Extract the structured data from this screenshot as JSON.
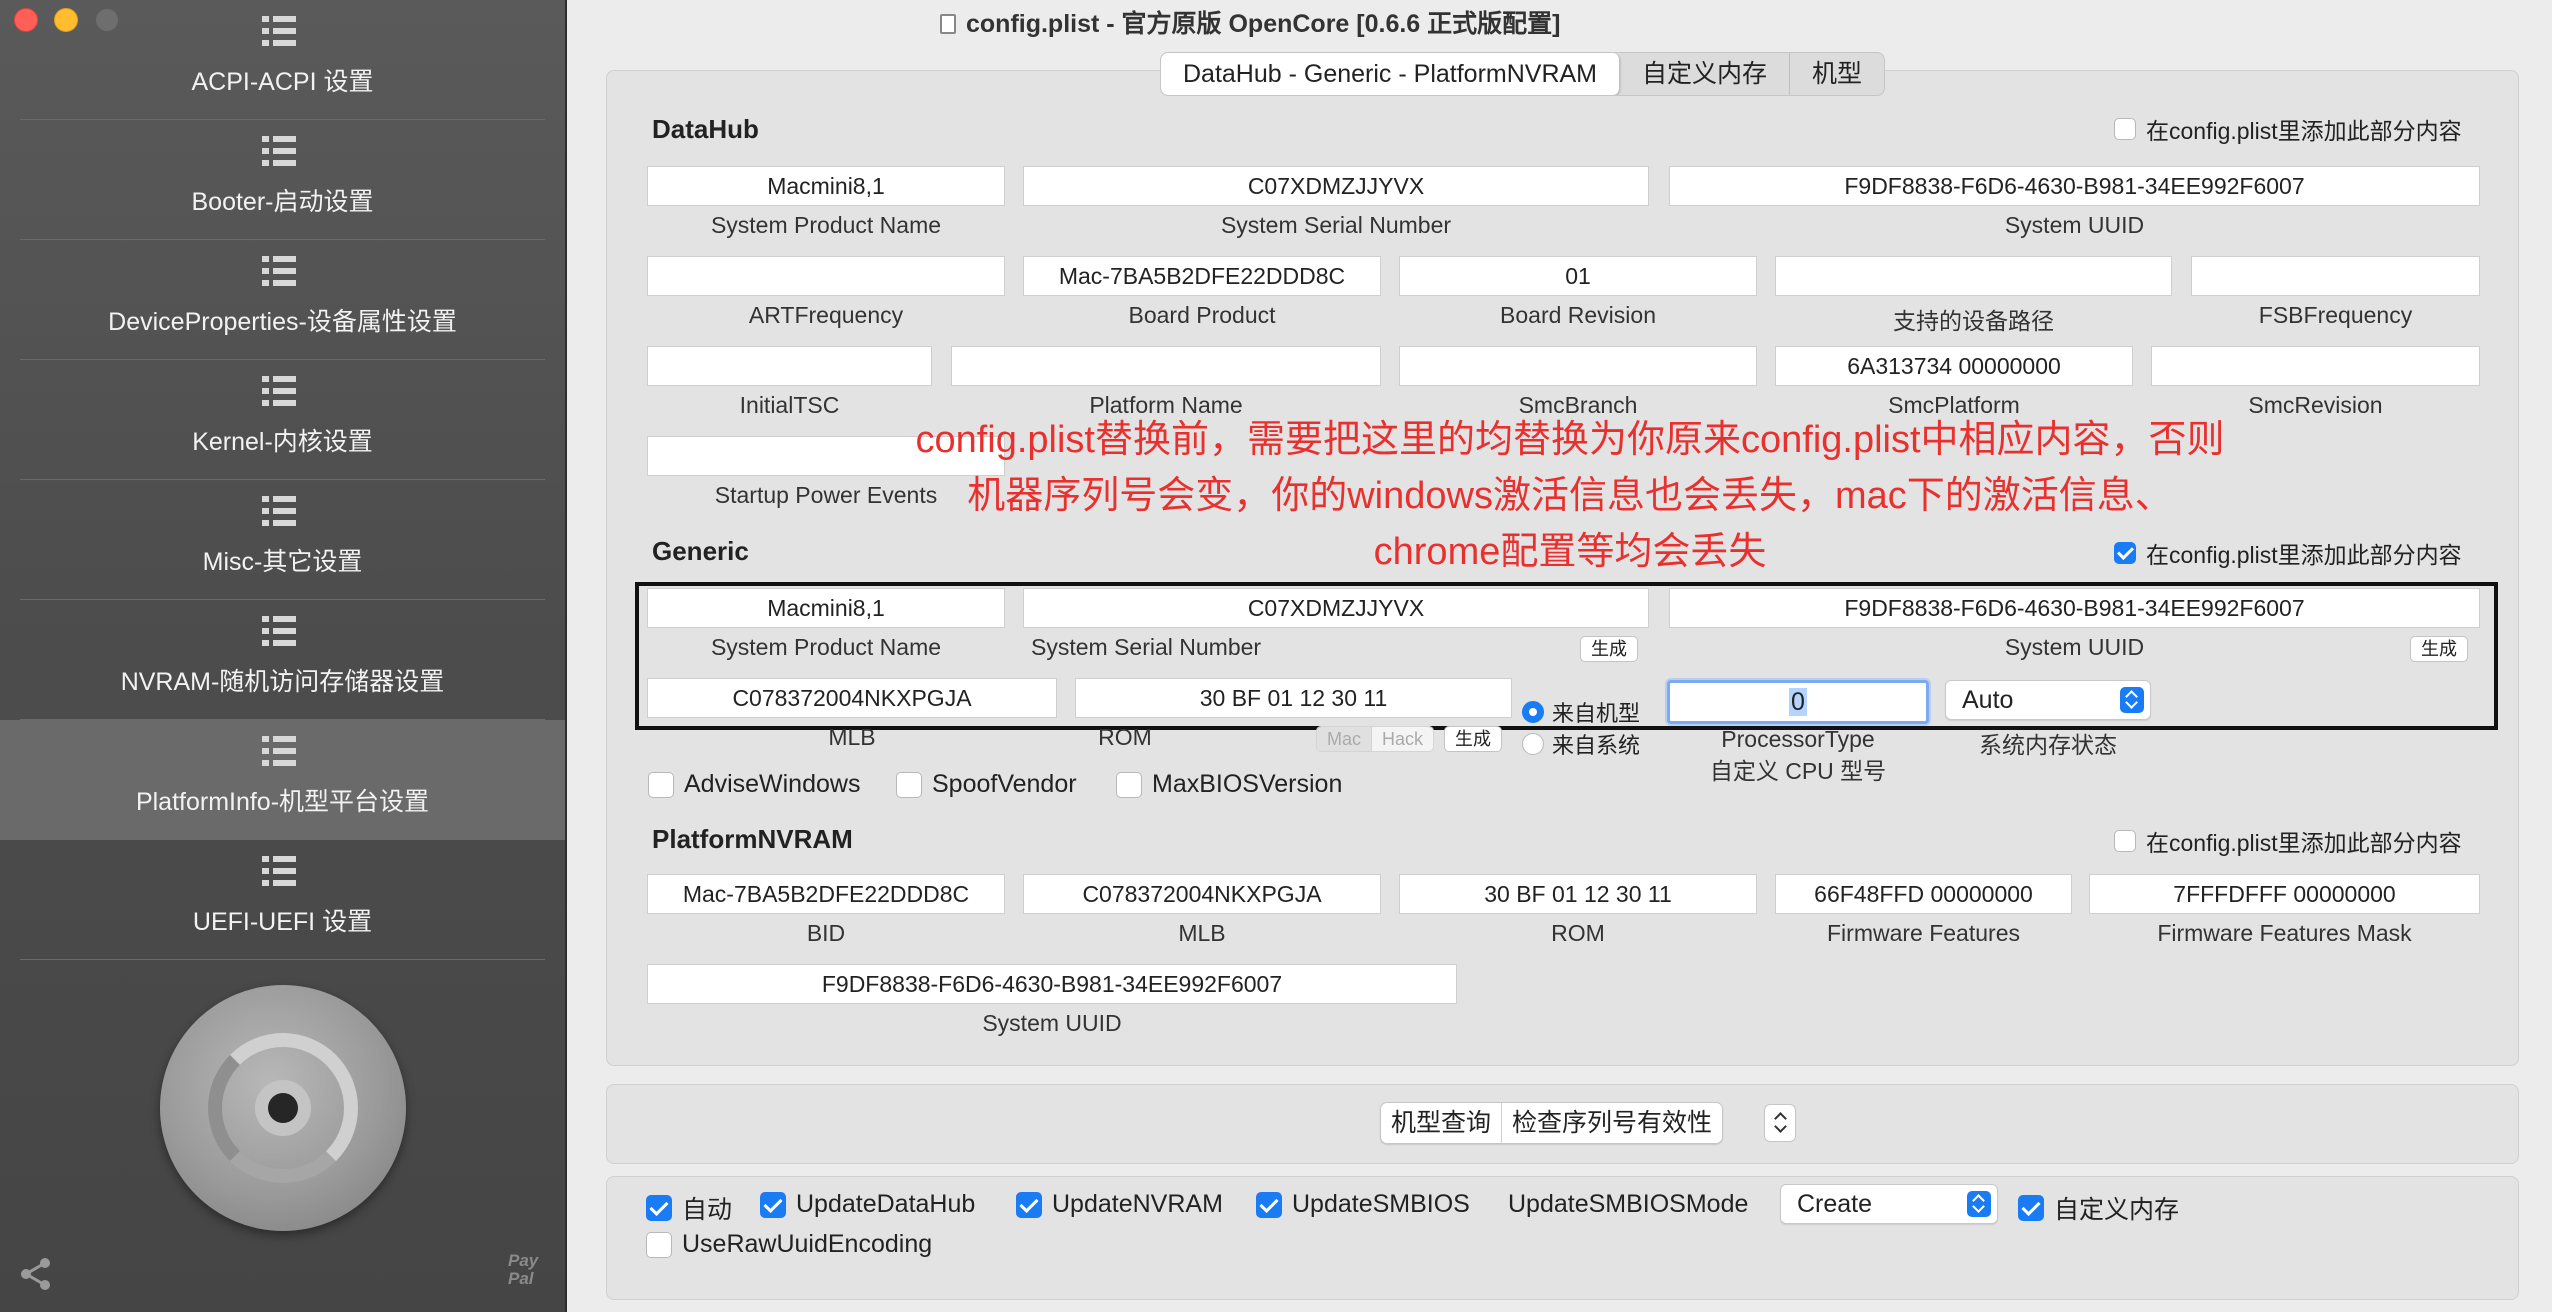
{
  "window": {
    "title": "config.plist - 官方原版 OpenCore [0.6.6 正式版配置]"
  },
  "sidebar": {
    "items": [
      {
        "label": "ACPI-ACPI 设置",
        "icon": "list-icon"
      },
      {
        "label": "Booter-启动设置",
        "icon": "list-icon"
      },
      {
        "label": "DeviceProperties-设备属性设置",
        "icon": "list-icon"
      },
      {
        "label": "Kernel-内核设置",
        "icon": "list-icon"
      },
      {
        "label": "Misc-其它设置",
        "icon": "list-icon"
      },
      {
        "label": "NVRAM-随机访问存储器设置",
        "icon": "list-icon"
      },
      {
        "label": "PlatformInfo-机型平台设置",
        "icon": "list-icon",
        "selected": true
      },
      {
        "label": "UEFI-UEFI 设置",
        "icon": "list-icon"
      }
    ],
    "paypal": "Pay Pal"
  },
  "tabs": [
    "DataHub - Generic - PlatformNVRAM",
    "自定义内存",
    "机型"
  ],
  "add_to_config_label": "在config.plist里添加此部分内容",
  "datahub": {
    "title": "DataHub",
    "add_checked": false,
    "row1": [
      {
        "value": "Macmini8,1",
        "label": "System Product Name"
      },
      {
        "value": "C07XDMZJJYVX",
        "label": "System Serial Number"
      },
      {
        "value": "F9DF8838-F6D6-4630-B981-34EE992F6007",
        "label": "System UUID"
      }
    ],
    "row2": [
      {
        "value": "",
        "label": "ARTFrequency"
      },
      {
        "value": "Mac-7BA5B2DFE22DDD8C",
        "label": "Board Product"
      },
      {
        "value": "01",
        "label": "Board Revision"
      },
      {
        "value": "",
        "label": "支持的设备路径"
      },
      {
        "value": "",
        "label": "FSBFrequency"
      }
    ],
    "row3": [
      {
        "value": "",
        "label": "InitialTSC"
      },
      {
        "value": "",
        "label": "Platform Name"
      },
      {
        "value": "",
        "label": "SmcBranch"
      },
      {
        "value": "6A313734 00000000",
        "label": "SmcPlatform"
      },
      {
        "value": "",
        "label": "SmcRevision"
      }
    ],
    "row4": [
      {
        "value": "",
        "label": "Startup Power Events"
      }
    ]
  },
  "annotation": "config.plist替换前，需要把这里的均替换为你原来config.plist中相应内容，否则机器序列号会变，你的windows激活信息也会丢失，mac下的激活信息、chrome配置等均会丢失",
  "generic": {
    "title": "Generic",
    "add_checked": true,
    "product_name": {
      "value": "Macmini8,1",
      "label": "System Product Name"
    },
    "serial": {
      "value": "C07XDMZJJYVX",
      "label": "System Serial Number"
    },
    "uuid": {
      "value": "F9DF8838-F6D6-4630-B981-34EE992F6007",
      "label": "System UUID"
    },
    "generate_label": "生成",
    "mlb": {
      "value": "C078372004NKXPGJA",
      "label": "MLB"
    },
    "rom": {
      "value": "30 BF 01 12 30 11",
      "label": "ROM"
    },
    "mac_label": "Mac",
    "hack_label": "Hack",
    "radio_from_model": "来自机型",
    "radio_from_system": "来自系统",
    "processor_type": {
      "value": "0",
      "label": "ProcessorType",
      "sublabel": "自定义 CPU 型号"
    },
    "memory_status": {
      "value": "Auto",
      "label": "系统内存状态"
    },
    "checkboxes": [
      {
        "label": "AdviseWindows",
        "checked": false
      },
      {
        "label": "SpoofVendor",
        "checked": false
      },
      {
        "label": "MaxBIOSVersion",
        "checked": false
      }
    ]
  },
  "platformnvram": {
    "title": "PlatformNVRAM",
    "add_checked": false,
    "row1": [
      {
        "value": "Mac-7BA5B2DFE22DDD8C",
        "label": "BID"
      },
      {
        "value": "C078372004NKXPGJA",
        "label": "MLB"
      },
      {
        "value": "30 BF 01 12 30 11",
        "label": "ROM"
      },
      {
        "value": "66F48FFD 00000000",
        "label": "Firmware Features"
      },
      {
        "value": "7FFFDFFF 00000000",
        "label": "Firmware Features Mask"
      }
    ],
    "row2": [
      {
        "value": "F9DF8838-F6D6-4630-B981-34EE992F6007",
        "label": "System UUID"
      }
    ]
  },
  "tools": {
    "model_lookup": "机型查询",
    "check_serial": "检查序列号有效性"
  },
  "bottom": {
    "checks": [
      {
        "label": "自动",
        "checked": true
      },
      {
        "label": "UpdateDataHub",
        "checked": true
      },
      {
        "label": "UpdateNVRAM",
        "checked": true
      },
      {
        "label": "UpdateSMBIOS",
        "checked": true
      }
    ],
    "update_mode_label": "UpdateSMBIOSMode",
    "update_mode_value": "Create",
    "custom_memory": {
      "label": "自定义内存",
      "checked": true
    },
    "raw_uuid": {
      "label": "UseRawUuidEncoding",
      "checked": false
    }
  }
}
